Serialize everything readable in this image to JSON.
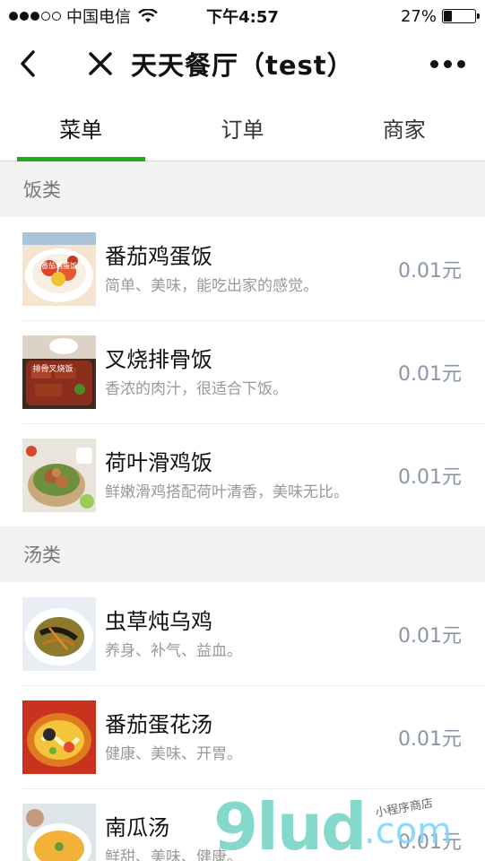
{
  "status": {
    "carrier": "中国电信",
    "time": "下午4:57",
    "battery_pct": 27,
    "battery_label": "27%"
  },
  "nav": {
    "title": "天天餐厅（test）"
  },
  "tabs": [
    {
      "label": "菜单",
      "active": true
    },
    {
      "label": "订单",
      "active": false
    },
    {
      "label": "商家",
      "active": false
    }
  ],
  "sections": [
    {
      "title": "饭类",
      "items": [
        {
          "name": "番茄鸡蛋饭",
          "desc": "简单、美味，能吃出家的感觉。",
          "price": "0.01元",
          "thumb_text": "番茄鸡蛋饭"
        },
        {
          "name": "叉烧排骨饭",
          "desc": "香浓的肉汁，很适合下饭。",
          "price": "0.01元",
          "thumb_text": "排骨叉烧饭"
        },
        {
          "name": "荷叶滑鸡饭",
          "desc": "鲜嫩滑鸡搭配荷叶清香，美味无比。",
          "price": "0.01元"
        }
      ]
    },
    {
      "title": "汤类",
      "items": [
        {
          "name": "虫草炖乌鸡",
          "desc": "养身、补气、益血。",
          "price": "0.01元"
        },
        {
          "name": "番茄蛋花汤",
          "desc": "健康、美味、开胃。",
          "price": "0.01元"
        },
        {
          "name": "南瓜汤",
          "desc": "鲜甜、美味、健康。",
          "price": "0.01元"
        }
      ]
    }
  ],
  "watermark": {
    "main": "9lud",
    "com": ".com",
    "sub": "小程序商店"
  },
  "colors": {
    "accent": "#1aad19",
    "price": "#8a96a8",
    "section_bg": "#f2f2f2"
  }
}
